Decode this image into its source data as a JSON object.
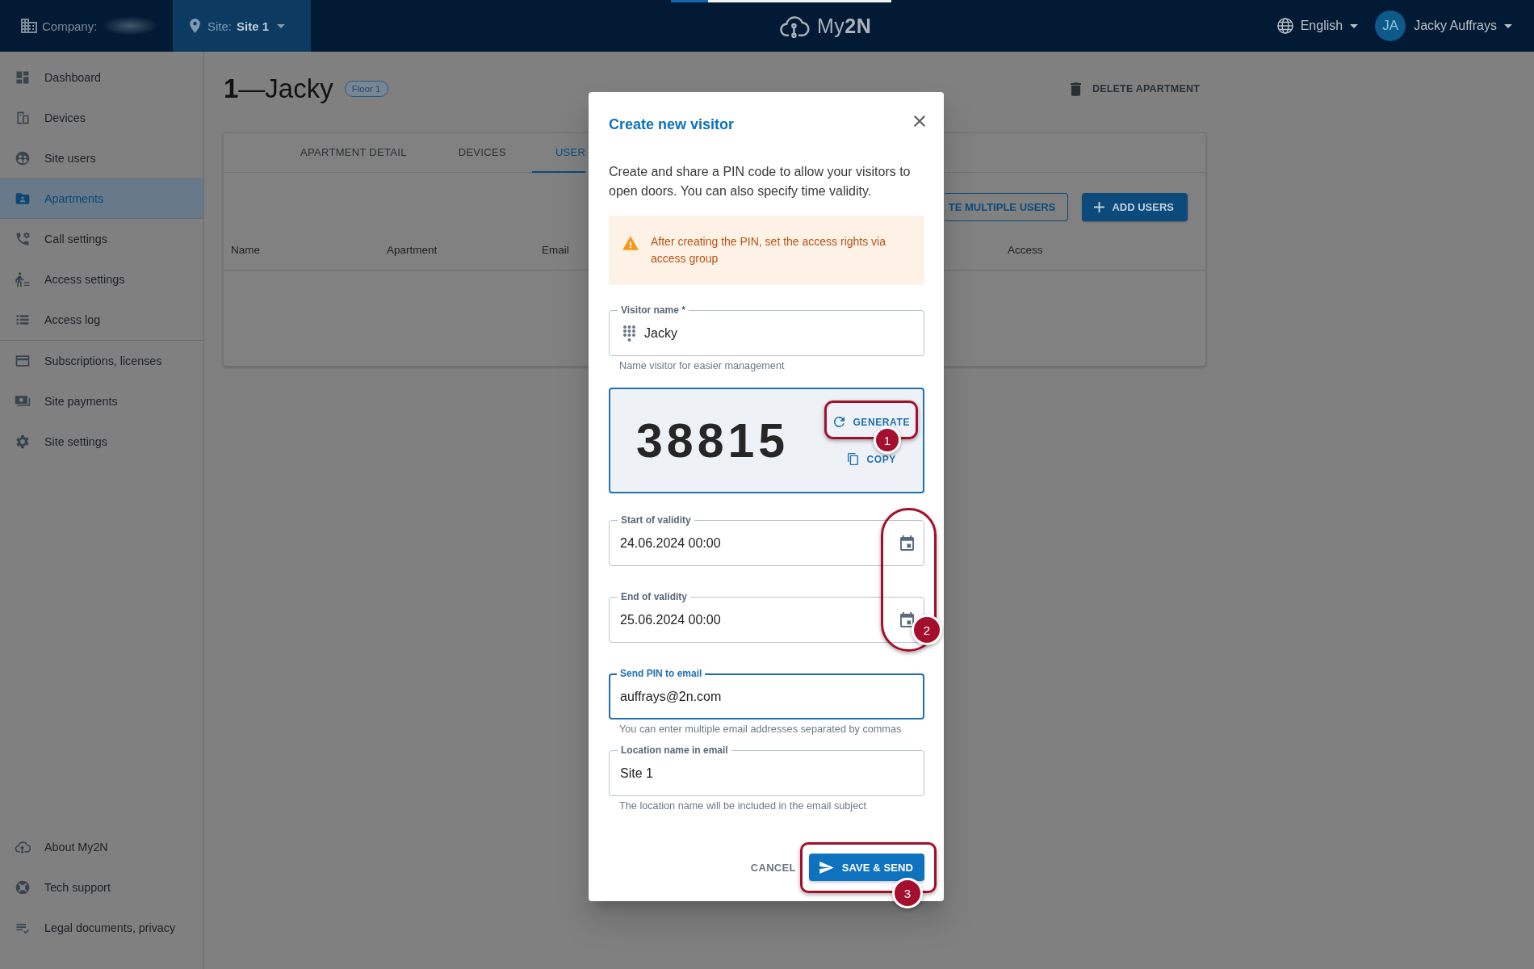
{
  "top_bar": {
    "company": {
      "label": "Company:"
    },
    "site": {
      "label": "Site:",
      "value": "Site 1"
    },
    "loading_bar": {
      "level": 0.17
    },
    "logo": "My**2N**",
    "language": "English",
    "user": {
      "initials": "JA",
      "name": "Jacky Auffrays"
    }
  },
  "sidebar": {
    "groups": [
      [
        {
          "label": "Dashboard",
          "selected": false
        },
        {
          "label": "Devices",
          "selected": false
        },
        {
          "label": "Site users",
          "selected": false
        },
        {
          "label": "Apartments",
          "selected": true
        },
        {
          "label": "Call settings",
          "selected": false
        },
        {
          "label": "Access settings",
          "selected": false
        },
        {
          "label": "Access log",
          "selected": false
        }
      ],
      [
        {
          "label": "Subscriptions, licenses",
          "selected": false
        },
        {
          "label": "Site payments",
          "selected": false
        },
        {
          "label": "Site settings",
          "selected": false
        }
      ]
    ],
    "footer": [
      {
        "label": "About My2N",
        "selected": false
      },
      {
        "label": "Tech support",
        "selected": false
      },
      {
        "label": "Legal documents, privacy",
        "selected": false
      }
    ]
  },
  "page": {
    "title": "**1**—Jacky",
    "badge": "Floor 1",
    "delete_button": "DELETE APARTMENT",
    "card": {
      "tabs": [
        {
          "label": "APARTMENT DETAIL",
          "selected": false
        },
        {
          "label": "DEVICES",
          "selected": false
        },
        {
          "label": "USER",
          "selected": true
        }
      ],
      "buttons": [
        {
          "label": "TE MULTIPLE USERS",
          "kind": "outlined"
        },
        {
          "label": "ADD USERS",
          "kind": "filled"
        }
      ],
      "table": {
        "columns": [
          "Name",
          "Apartment",
          "Email",
          "Access"
        ]
      }
    }
  },
  "dialog": {
    "title": "Create new visitor",
    "description": "Create and share a PIN code to allow your visitors to open doors. You can also specify time validity.",
    "warning": "After creating the PIN, set the access rights via access group",
    "name_field": {
      "label": "Visitor name *",
      "value": "Jacky",
      "helper": "Name visitor for easier management",
      "focused": false
    },
    "pin": {
      "code": "38815",
      "generate": "GENERATE",
      "copy": "COPY"
    },
    "fields": [
      {
        "kind": "date",
        "label": "Start of validity",
        "value": "24.06.2024 00:00",
        "focused": false
      },
      {
        "kind": "date",
        "label": "End of validity",
        "value": "25.06.2024 00:00",
        "focused": false
      },
      {
        "kind": "text",
        "label": "Send PIN to email",
        "value": "auffrays@2n.com",
        "helper": "You can enter multiple email addresses separated by commas",
        "focused": true
      },
      {
        "kind": "text",
        "label": "Location name in email",
        "value": "Site 1",
        "helper": "The location name will be included in the email subject",
        "focused": false
      }
    ],
    "actions": {
      "cancel": "CANCEL",
      "submit": "SAVE & SEND"
    },
    "annotations": [
      {
        "label": "1"
      },
      {
        "label": "2"
      },
      {
        "label": "3"
      }
    ]
  }
}
